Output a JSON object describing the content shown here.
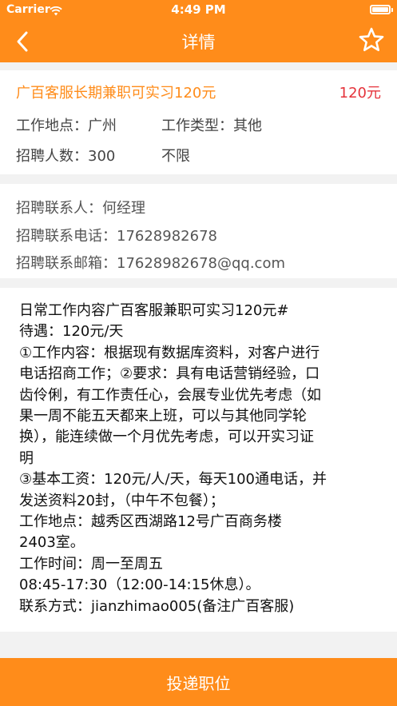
{
  "status_bar": {
    "carrier": "Carrier",
    "time": "4:49 PM"
  },
  "nav": {
    "title": "详情",
    "back_icon": "chevron-left",
    "star_icon": "star-outline"
  },
  "job": {
    "title": "广百客服长期兼职可实习120元",
    "salary": "120元",
    "location_label": "工作地点：",
    "location": "广州",
    "type_label": "工作类型：",
    "type": "其他",
    "headcount_label": "招聘人数：",
    "headcount": "300",
    "limit": "不限"
  },
  "contact": {
    "person_label": "招聘联系人：",
    "person": "何经理",
    "phone_label": "招聘联系电话：",
    "phone": "17628982678",
    "email_label": "招聘联系邮箱：",
    "email": "17628982678@qq.com"
  },
  "description": {
    "lines": [
      "日常工作内容广百客服兼职可实习120元#",
      "待遇：120元/天",
      "①工作内容：根据现有数据库资料，对客户进行",
      "电话招商工作；②要求：具有电话营销经验，口",
      "齿伶俐，有工作责任心，会展专业优先考虑（如",
      "果一周不能五天都来上班，可以与其他同学轮",
      "换），能连续做一个月优先考虑，可以开实习证",
      "明",
      "③基本工资：120元/人/天，每天100通电话，并",
      "发送资料20封，（中午不包餐）；",
      "工作地点：越秀区西湖路12号广百商务楼",
      "2403室。",
      "工作时间：周一至周五",
      "08:45-17:30（12:00-14:15休息）。",
      "联系方式：jianzhimao005(备注广百客服)"
    ]
  },
  "apply_button": {
    "label": "投递职位"
  },
  "colors": {
    "accent": "#ff8c1a",
    "salary": "#e5333b",
    "background": "#f2f2f2"
  }
}
